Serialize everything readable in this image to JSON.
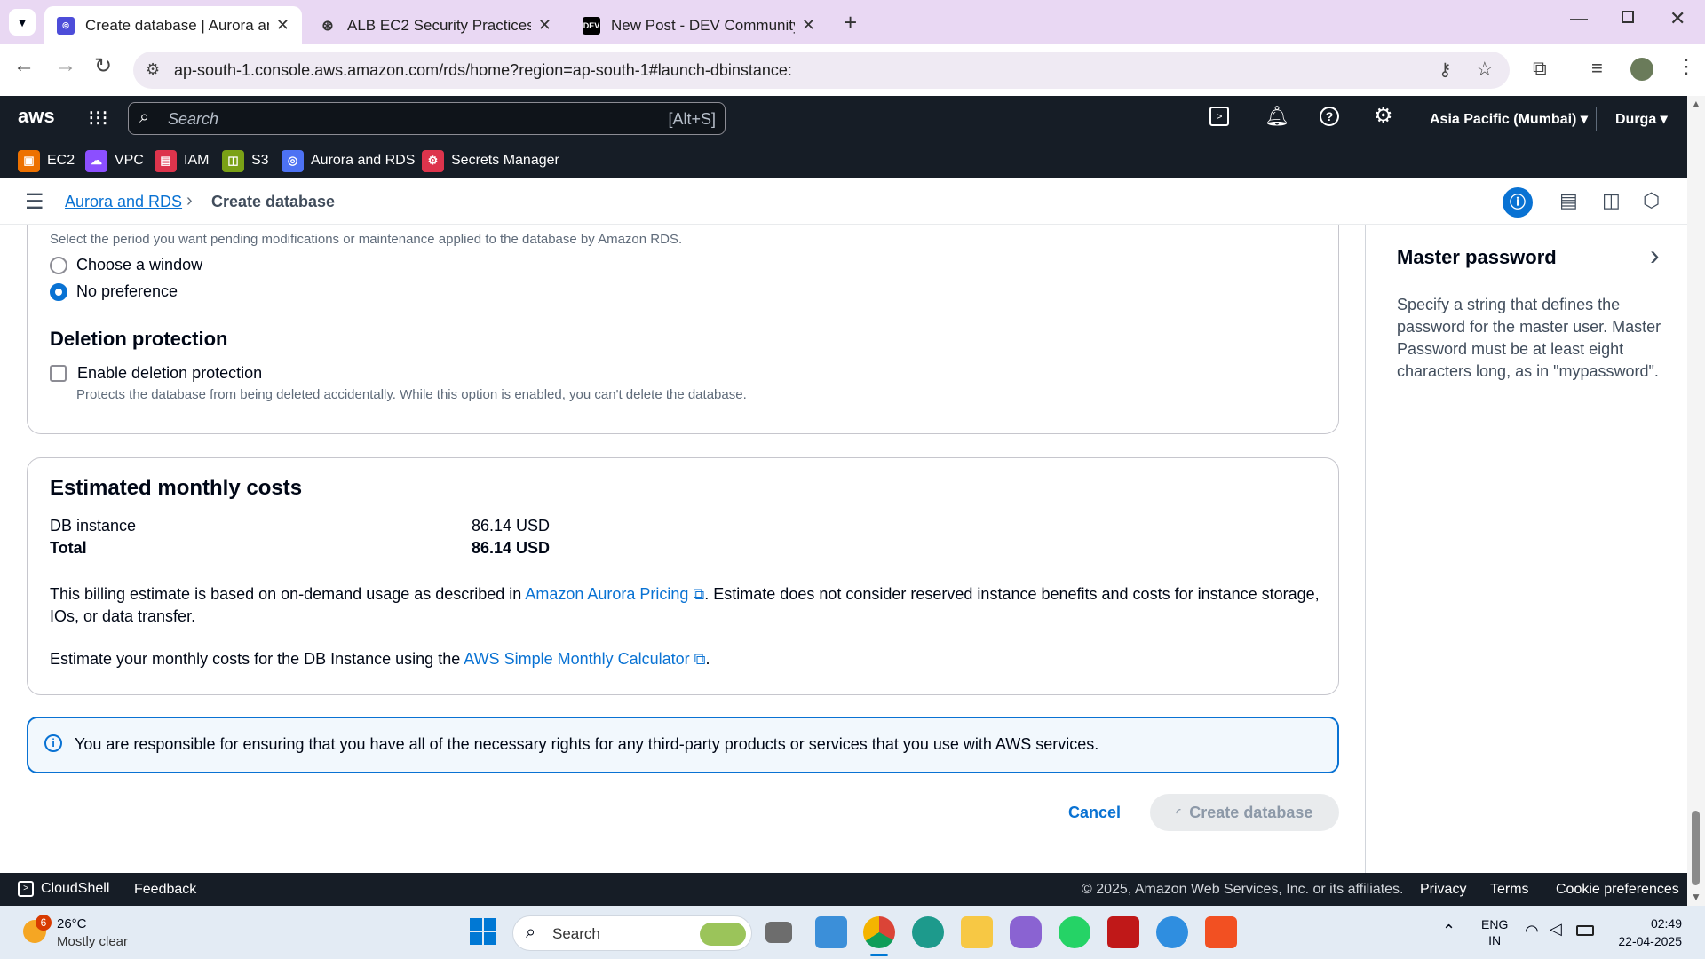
{
  "browser": {
    "tabs": [
      {
        "title": "Create database | Aurora and RDS",
        "active": true
      },
      {
        "title": "ALB EC2 Security Practices",
        "active": false
      },
      {
        "title": "New Post - DEV Community",
        "active": false
      }
    ],
    "url": "ap-south-1.console.aws.amazon.com/rds/home?region=ap-south-1#launch-dbinstance:"
  },
  "aws": {
    "logo": "aws",
    "search_placeholder": "Search",
    "search_shortcut": "[Alt+S]",
    "region": "Asia Pacific (Mumbai)",
    "user": "Durga",
    "favorites": [
      "EC2",
      "VPC",
      "IAM",
      "S3",
      "Aurora and RDS",
      "Secrets Manager"
    ],
    "favorite_colors": [
      "#ed7100",
      "#8c4fff",
      "#dd344c",
      "#7aa116",
      "#4d72f3",
      "#dd344c"
    ]
  },
  "breadcrumb": {
    "parent": "Aurora and RDS",
    "current": "Create database"
  },
  "maintenance": {
    "description": "Select the period you want pending modifications or maintenance applied to the database by Amazon RDS.",
    "options": [
      "Choose a window",
      "No preference"
    ],
    "selected": "No preference"
  },
  "deletion": {
    "heading": "Deletion protection",
    "label": "Enable deletion protection",
    "description": "Protects the database from being deleted accidentally. While this option is enabled, you can't delete the database."
  },
  "costs": {
    "heading": "Estimated monthly costs",
    "rows": [
      {
        "label": "DB instance",
        "value": "86.14 USD"
      },
      {
        "label": "Total",
        "value": "86.14 USD"
      }
    ],
    "note1_pre": "This billing estimate is based on on-demand usage as described in ",
    "note1_link": "Amazon Aurora Pricing",
    "note1_post": ". Estimate does not consider reserved instance benefits and costs for instance storage,",
    "note1_line2": "IOs, or data transfer.",
    "note2_pre": "Estimate your monthly costs for the DB Instance using the ",
    "note2_link": "AWS Simple Monthly Calculator",
    "note2_post": "."
  },
  "info_alert": "You are responsible for ensuring that you have all of the necessary rights for any third-party products or services that you use with AWS services.",
  "actions": {
    "cancel": "Cancel",
    "create": "Create database"
  },
  "help_panel": {
    "title": "Master password",
    "body": "Specify a string that defines the password for the master user. Master Password must be at least eight characters long, as in \"mypassword\"."
  },
  "footer": {
    "cloudshell": "CloudShell",
    "feedback": "Feedback",
    "copyright": "© 2025, Amazon Web Services, Inc. or its affiliates.",
    "privacy": "Privacy",
    "terms": "Terms",
    "cookies": "Cookie preferences"
  },
  "taskbar": {
    "weather_temp": "26°C",
    "weather_desc": "Mostly clear",
    "weather_badge": "6",
    "search": "Search",
    "lang1": "ENG",
    "lang2": "IN",
    "time": "02:49",
    "date": "22-04-2025"
  }
}
